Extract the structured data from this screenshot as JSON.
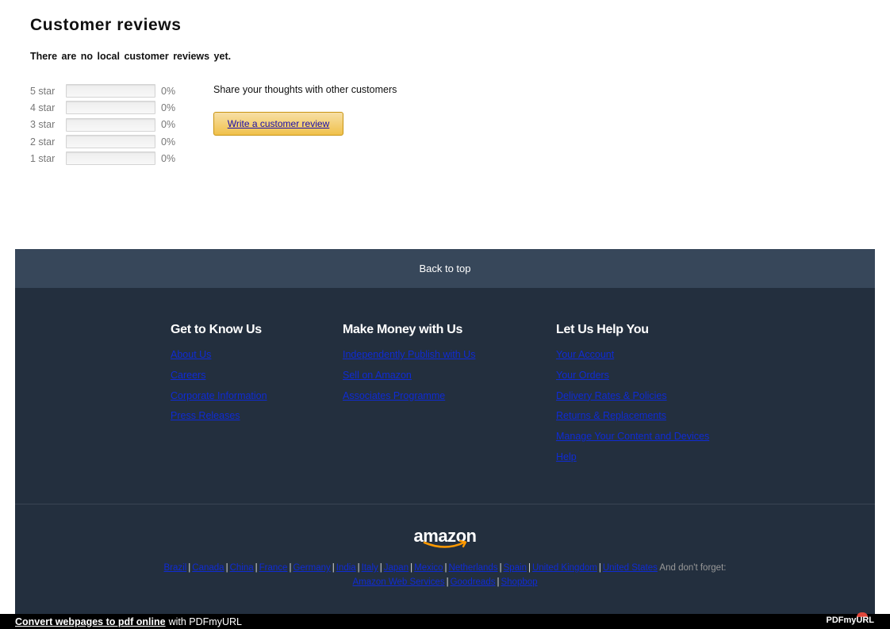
{
  "reviews": {
    "title": "Customer reviews",
    "no_reviews": "There are no local customer reviews yet.",
    "histogram": [
      {
        "label": "5 star",
        "percent": "0%",
        "fill": 0
      },
      {
        "label": "4 star",
        "percent": "0%",
        "fill": 0
      },
      {
        "label": "3 star",
        "percent": "0%",
        "fill": 0
      },
      {
        "label": "2 star",
        "percent": "0%",
        "fill": 0
      },
      {
        "label": "1 star",
        "percent": "0%",
        "fill": 0
      }
    ],
    "share_text": "Share your thoughts with other customers",
    "write_button": "Write a customer review"
  },
  "footer": {
    "back_to_top": "Back to top",
    "columns": [
      {
        "title": "Get to Know Us",
        "links": [
          "About Us",
          "Careers",
          "Corporate Information",
          "Press Releases"
        ]
      },
      {
        "title": "Make Money with Us",
        "links": [
          "Independently Publish with Us",
          "Sell on Amazon",
          "Associates Programme"
        ]
      },
      {
        "title": "Let Us Help You",
        "links": [
          "Your Account",
          "Your Orders",
          "Delivery Rates & Policies",
          "Returns & Replacements",
          "Manage Your Content and Devices",
          "Help"
        ]
      }
    ],
    "logo_text": "amazon",
    "locales": [
      "Brazil",
      "Canada",
      "China",
      "France",
      "Germany",
      "India",
      "Italy",
      "Japan",
      "Mexico",
      "Netherlands",
      "Spain",
      "United Kingdom",
      "United States"
    ],
    "dont_forget": "And don't forget:",
    "extra_links": [
      "Amazon Web Services",
      "Goodreads",
      "Shopbop"
    ],
    "colors": {
      "back_to_top_bg": "#37475a",
      "footer_bg": "#232f3e",
      "logo_smile": "#ff9900"
    }
  },
  "pdfbar": {
    "link_text": "Convert webpages to pdf online",
    "suffix": "with PDFmyURL",
    "logo_text": "PDFmyURL"
  }
}
